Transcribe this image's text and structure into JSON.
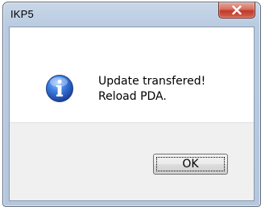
{
  "window": {
    "title": "IKP5",
    "close_icon": "close-icon"
  },
  "dialog": {
    "icon": "information-icon",
    "message_line1": "Update transfered!",
    "message_line2": "Reload PDA.",
    "ok_label": "OK"
  },
  "colors": {
    "close_button": "#c0392b",
    "title_bar": "#b9cbe1",
    "info_icon": "#2b63c6"
  }
}
